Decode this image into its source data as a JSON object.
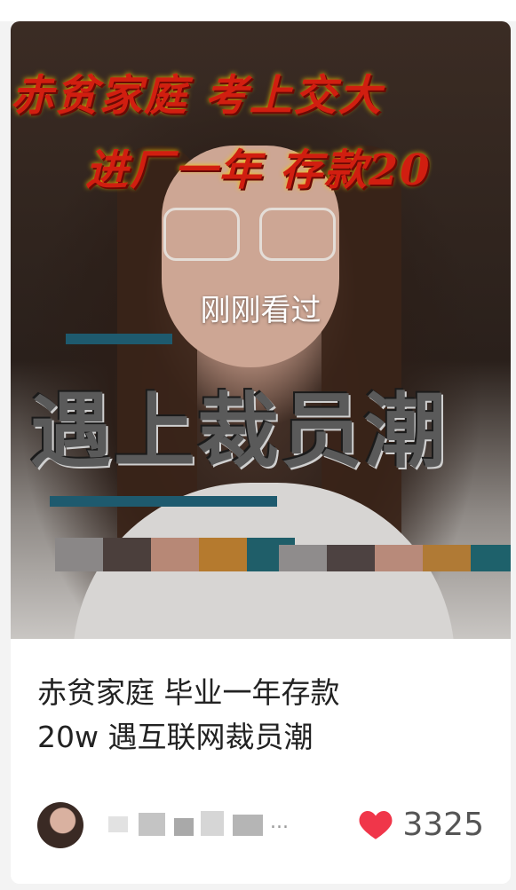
{
  "card": {
    "cover": {
      "overlay_line1": "赤贫家庭 考上交大",
      "overlay_line2": "进厂一年 存款20",
      "watched_label": "刚刚看过",
      "big_text": "遇上裁员潮",
      "swatch_colors_row1": [
        "#8a8787",
        "#4b3f3c",
        "#b78876",
        "#b57a2e",
        "#1f5e69"
      ],
      "swatch_colors_row2": [
        "#8f8c8c",
        "#4d4241",
        "#b88a7a",
        "#b07a35",
        "#1e616b"
      ]
    },
    "title_line1": "赤贫家庭 毕业一年存款",
    "title_line2": "20w 遇互联网裁员潮",
    "author": {
      "avatar_icon": "user-avatar",
      "name_blurred": true,
      "ellipsis": "..."
    },
    "likes": {
      "icon": "heart-icon",
      "count": "3325",
      "heart_color": "#f0364a"
    }
  }
}
